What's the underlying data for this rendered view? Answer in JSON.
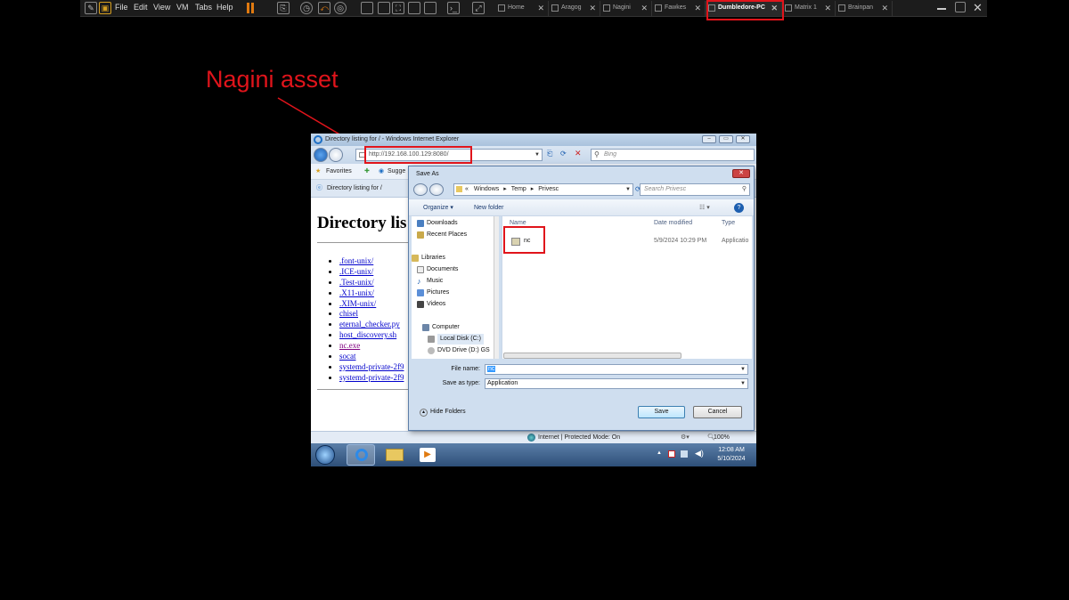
{
  "vmware": {
    "menus": [
      "File",
      "Edit",
      "View",
      "VM",
      "Tabs",
      "Help"
    ],
    "tabs": [
      {
        "label": "Home"
      },
      {
        "label": "Aragog"
      },
      {
        "label": "Nagini"
      },
      {
        "label": "Fawkes"
      },
      {
        "label": "Dumbledore-PC"
      },
      {
        "label": "Matrix 1"
      },
      {
        "label": "Brainpan"
      }
    ],
    "active_tab": "Dumbledore-PC"
  },
  "annotation": {
    "text": "Nagini asset",
    "color": "#e0141b"
  },
  "ie": {
    "title": "Directory listing for / - Windows Internet Explorer",
    "address": "http://192.168.100.129:8080/",
    "search_placeholder": "Bing",
    "favorites_label": "Favorites",
    "suggested_label": "Sugge",
    "tab_label": "Directory listing for /",
    "page_heading": "Directory lis",
    "listing": [
      ".font-unix/",
      ".ICE-unix/",
      ".Test-unix/",
      ".X11-unix/",
      ".XIM-unix/",
      "chisel",
      "eternal_checker.py",
      "host_discovery.sh",
      "nc.exe",
      "socat",
      "systemd-private-2f9",
      "systemd-private-2f9"
    ],
    "status_zone": "Internet | Protected Mode: On",
    "zoom": "100%"
  },
  "save_dialog": {
    "title": "Save As",
    "path": [
      "Windows",
      "Temp",
      "Privesc"
    ],
    "path_prefix": "«",
    "search_placeholder": "Search Privesc",
    "organize_label": "Organize",
    "new_folder_label": "New folder",
    "sidebar": {
      "favorites": [
        "Downloads",
        "Recent Places"
      ],
      "libraries_header": "Libraries",
      "libraries": [
        "Documents",
        "Music",
        "Pictures",
        "Videos"
      ],
      "computer_header": "Computer",
      "drives": [
        "Local Disk (C:)",
        "DVD Drive (D:) GS"
      ]
    },
    "columns": {
      "name": "Name",
      "date": "Date modified",
      "type": "Type"
    },
    "files": [
      {
        "name": "nc",
        "date": "5/9/2024 10:29 PM",
        "type": "Applicatio"
      }
    ],
    "file_name_label": "File name:",
    "file_name_value": "nc",
    "save_type_label": "Save as type:",
    "save_type_value": "Application",
    "hide_folders_label": "Hide Folders",
    "save_label": "Save",
    "cancel_label": "Cancel"
  },
  "win_taskbar": {
    "time": "12:08 AM",
    "date": "5/10/2024"
  }
}
